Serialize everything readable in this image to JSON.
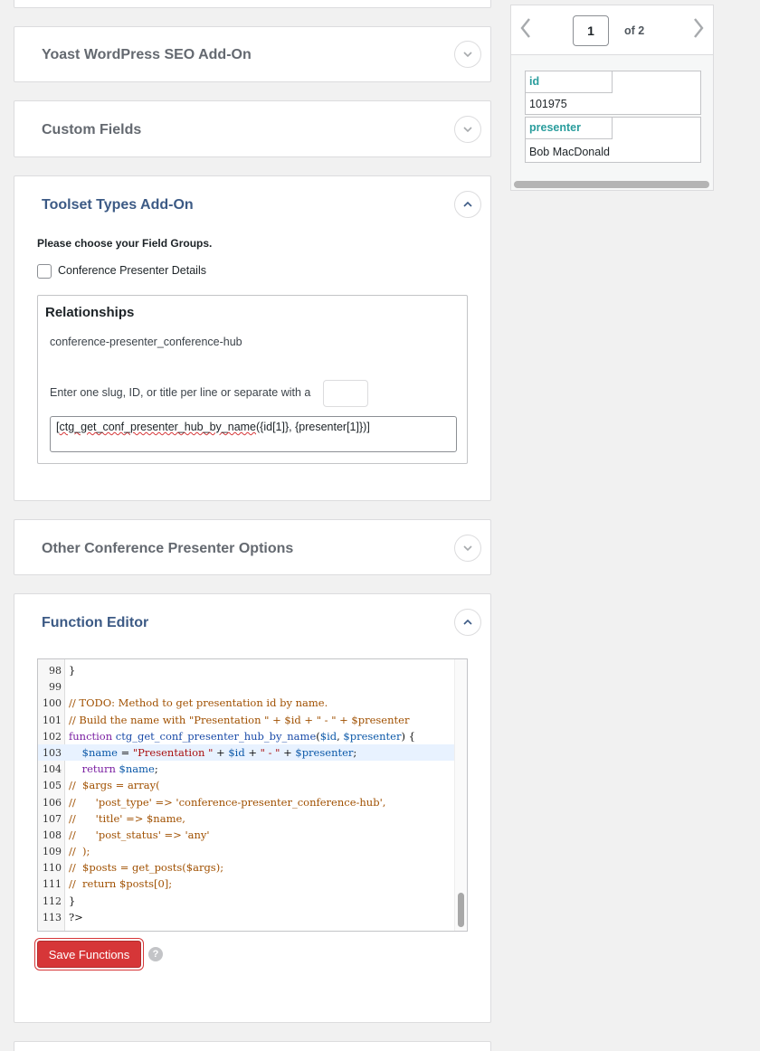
{
  "panels": {
    "yoast": {
      "title": "Yoast WordPress SEO Add-On"
    },
    "custom_fields": {
      "title": "Custom Fields"
    },
    "toolset": {
      "title": "Toolset Types Add-On",
      "choose_label": "Please choose your Field Groups.",
      "field_group": "Conference Presenter Details",
      "relationships": {
        "title": "Relationships",
        "slug": "conference-presenter_conference-hub",
        "hint": "Enter one slug, ID, or title per line or separate with a",
        "separator_value": "",
        "value_fn": "ctg_get_conf_presenter_hub_by_name",
        "value_args": "({id[1]}, {presenter[1]})]",
        "value_open": "["
      }
    },
    "other_options": {
      "title": "Other Conference Presenter Options"
    },
    "function_editor": {
      "title": "Function Editor",
      "save_label": "Save Functions",
      "help": "?",
      "lines": [
        {
          "n": "98",
          "t": "}"
        },
        {
          "n": "99",
          "t": ""
        },
        {
          "n": "100",
          "t": "// TODO: Method to get presentation id by name."
        },
        {
          "n": "101",
          "t": "// Build the name with \"Presentation \" + $id + \" - \" + $presenter"
        },
        {
          "n": "102",
          "t": "function ctg_get_conf_presenter_hub_by_name($id, $presenter) {"
        },
        {
          "n": "103",
          "t": "    $name = \"Presentation \" + $id + \" - \" + $presenter;"
        },
        {
          "n": "104",
          "t": "    return $name;"
        },
        {
          "n": "105",
          "t": "//  $args = array("
        },
        {
          "n": "106",
          "t": "//      'post_type' => 'conference-presenter_conference-hub',"
        },
        {
          "n": "107",
          "t": "//      'title' => $name,"
        },
        {
          "n": "108",
          "t": "//      'post_status' => 'any'"
        },
        {
          "n": "109",
          "t": "//  );"
        },
        {
          "n": "110",
          "t": "//  $posts = get_posts($args);"
        },
        {
          "n": "111",
          "t": "//  return $posts[0];"
        },
        {
          "n": "112",
          "t": "}"
        },
        {
          "n": "113",
          "t": "?>"
        }
      ]
    }
  },
  "preview": {
    "page": "1",
    "of_label": "of 2",
    "records": [
      {
        "key": "id",
        "value": "101975"
      },
      {
        "key": "presenter",
        "value": "Bob MacDonald"
      }
    ]
  },
  "colors": {
    "accent": "#3c5a85",
    "danger": "#d63638",
    "teal": "#2a9d9d"
  },
  "icons": {
    "expand": "chevron-down-icon",
    "collapse": "chevron-up-icon",
    "prev": "chevron-left-icon",
    "next": "chevron-right-icon"
  }
}
